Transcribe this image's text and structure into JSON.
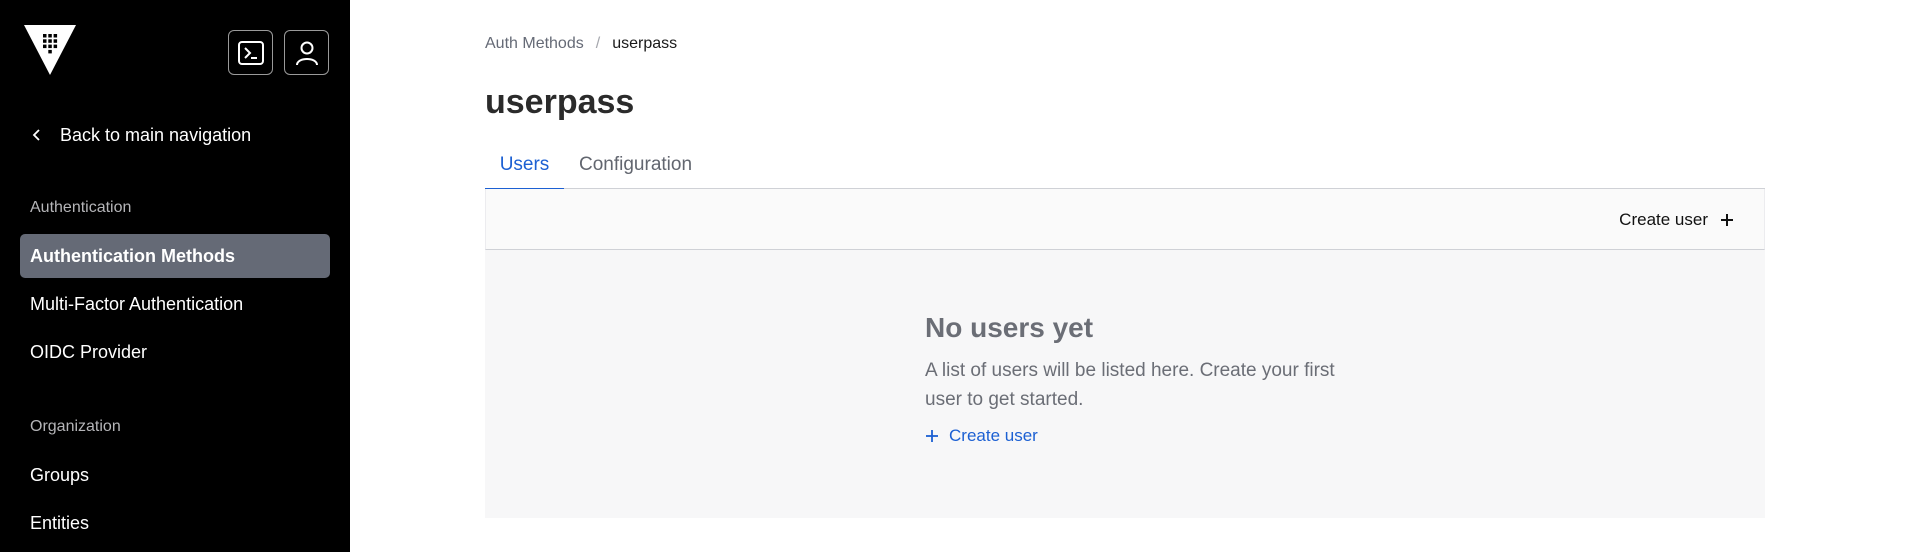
{
  "sidebar": {
    "back_label": "Back to main navigation",
    "sections": [
      {
        "label": "Authentication",
        "items": [
          {
            "label": "Authentication Methods",
            "active": true
          },
          {
            "label": "Multi-Factor Authentication",
            "active": false
          },
          {
            "label": "OIDC Provider",
            "active": false
          }
        ]
      },
      {
        "label": "Organization",
        "items": [
          {
            "label": "Groups",
            "active": false
          },
          {
            "label": "Entities",
            "active": false
          }
        ]
      }
    ],
    "icons": [
      "vault-logo-icon",
      "terminal-icon",
      "user-icon",
      "chevron-left-icon"
    ]
  },
  "breadcrumb": {
    "parent": "Auth Methods",
    "separator": "/",
    "current": "userpass"
  },
  "page": {
    "title": "userpass"
  },
  "tabs": [
    {
      "label": "Users",
      "active": true
    },
    {
      "label": "Configuration",
      "active": false
    }
  ],
  "toolbar": {
    "create_label": "Create user"
  },
  "empty_state": {
    "title": "No users yet",
    "message": "A list of users will be listed here. Create your first user to get started.",
    "link_label": "Create user"
  },
  "colors": {
    "sidebar_bg": "#000000",
    "active_nav_bg": "#656a76",
    "accent": "#1c60d3",
    "empty_bg": "#f7f7f8"
  }
}
